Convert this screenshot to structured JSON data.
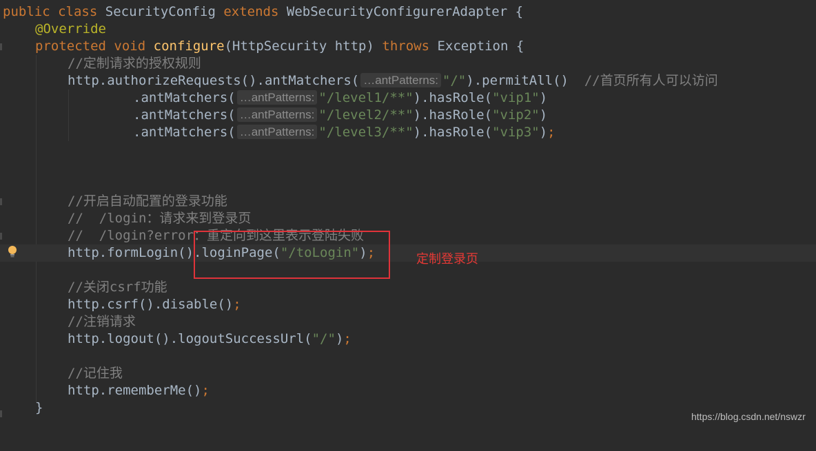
{
  "colors": {
    "background": "#2b2b2b",
    "keyword": "#cc7832",
    "annotation": "#bbb529",
    "method_decl": "#ffc66d",
    "string": "#6a8759",
    "comment": "#808080",
    "default_text": "#a9b7c6",
    "callout_red": "#e53935"
  },
  "code": {
    "l1": {
      "kw1": "public",
      "kw2": "class",
      "name": "SecurityConfig",
      "kw3": "extends",
      "parent": "WebSecurityConfigurerAdapter",
      "brace": "{"
    },
    "l2": {
      "annotation": "@Override"
    },
    "l3": {
      "kw1": "protected",
      "kw2": "void",
      "method": "configure",
      "params": "(HttpSecurity http)",
      "kw3": "throws",
      "exc": "Exception",
      "brace": "{"
    },
    "l4": {
      "comment": "//定制请求的授权规则"
    },
    "l5": {
      "pre": "http.authorizeRequests().antMatchers(",
      "hint": "…antPatterns:",
      "str": "\"/\"",
      "post": ").permitAll()",
      "comment": "//首页所有人可以访问"
    },
    "l6": {
      "pre": ".antMatchers(",
      "hint": "…antPatterns:",
      "str": "\"/level1/**\"",
      "mid": ").hasRole(",
      "str2": "\"vip1\"",
      "post": ")"
    },
    "l7": {
      "pre": ".antMatchers(",
      "hint": "…antPatterns:",
      "str": "\"/level2/**\"",
      "mid": ").hasRole(",
      "str2": "\"vip2\"",
      "post": ")"
    },
    "l8": {
      "pre": ".antMatchers(",
      "hint": "…antPatterns:",
      "str": "\"/level3/**\"",
      "mid": ").hasRole(",
      "str2": "\"vip3\"",
      "post": ")",
      "semi": ";"
    },
    "l9": {
      "comment": "//开启自动配置的登录功能"
    },
    "l10": {
      "comment": "//  /login：请求来到登录页"
    },
    "l11": {
      "comment": "//  /login?error：重定向到这里表示登陆失败"
    },
    "l12": {
      "pre": "http.formLogin().loginPage(",
      "str": "\"/toLogin\"",
      "post": ")",
      "semi": ";"
    },
    "l13": {
      "comment": "//关闭csrf功能"
    },
    "l14": {
      "pre": "http.csrf().disable()",
      "semi": ";"
    },
    "l15": {
      "comment": "//注销请求"
    },
    "l16": {
      "pre": "http.logout().logoutSuccessUrl(",
      "str": "\"/\"",
      "post": ")",
      "semi": ";"
    },
    "l17": {
      "comment": "//记住我"
    },
    "l18": {
      "pre": "http.rememberMe()",
      "semi": ";"
    },
    "l19": {
      "brace": "}"
    }
  },
  "callout": {
    "label": "定制登录页"
  },
  "watermark": "https://blog.csdn.net/nswzr"
}
